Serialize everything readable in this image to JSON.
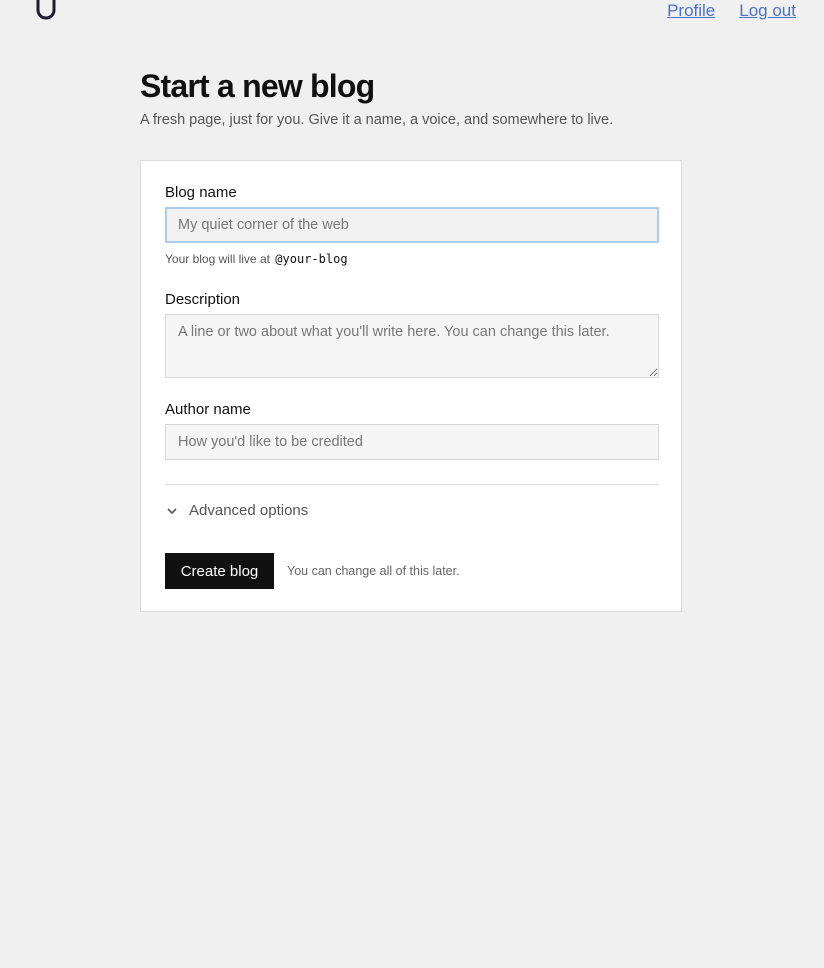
{
  "nav": {
    "logo_icon": "u-logo-icon",
    "profile_label": "Profile",
    "logout_label": "Log out",
    "link_color": "#4a72c9"
  },
  "header": {
    "title": "Start a new blog",
    "subtitle": "A fresh page, just for you. Give it a name, a voice, and somewhere to live."
  },
  "form": {
    "blog_name": {
      "label": "Blog name",
      "placeholder": "My quiet corner of the web",
      "value": "",
      "hint_prefix": "Your blog will live at",
      "hint_handle": "@your-blog"
    },
    "description": {
      "label": "Description",
      "placeholder": "A line or two about what you'll write here. You can change this later.",
      "value": ""
    },
    "author_name": {
      "label": "Author name",
      "placeholder": "How you'd like to be credited",
      "value": ""
    },
    "advanced": {
      "label": "Advanced options",
      "icon": "chevron-down-icon"
    },
    "submit_label": "Create blog",
    "footnote": "You can change all of this later."
  },
  "colors": {
    "background": "#f0f0f0",
    "primary_button": "#111111",
    "focus_ring": "#a9cdea"
  }
}
